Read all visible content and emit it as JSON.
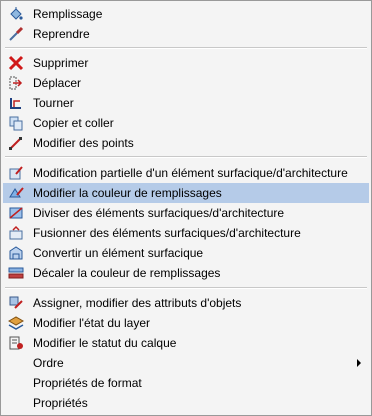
{
  "menu": {
    "items": [
      {
        "label": "Remplissage",
        "icon": "paint-bucket-icon"
      },
      {
        "label": "Reprendre",
        "icon": "eyedropper-icon"
      },
      {
        "label": "Supprimer",
        "icon": "delete-x-icon"
      },
      {
        "label": "Déplacer",
        "icon": "move-icon"
      },
      {
        "label": "Tourner",
        "icon": "rotate-icon"
      },
      {
        "label": "Copier et coller",
        "icon": "copy-icon"
      },
      {
        "label": "Modifier des points",
        "icon": "edit-points-icon"
      },
      {
        "label": "Modification partielle d'un élément surfacique/d'architecture",
        "icon": "partial-edit-icon"
      },
      {
        "label": "Modifier la couleur de remplissages",
        "icon": "fill-color-icon"
      },
      {
        "label": "Diviser des éléments surfaciques/d'architecture",
        "icon": "divide-icon"
      },
      {
        "label": "Fusionner des éléments surfaciques/d'architecture",
        "icon": "merge-icon"
      },
      {
        "label": "Convertir un élément surfacique",
        "icon": "convert-icon"
      },
      {
        "label": "Décaler la couleur de remplissages",
        "icon": "offset-color-icon"
      },
      {
        "label": "Assigner, modifier des attributs d'objets",
        "icon": "attributes-icon"
      },
      {
        "label": "Modifier l'état du layer",
        "icon": "layer-state-icon"
      },
      {
        "label": "Modifier le statut du calque",
        "icon": "calque-status-icon"
      },
      {
        "label": "Ordre"
      },
      {
        "label": "Propriétés de format"
      },
      {
        "label": "Propriétés"
      }
    ],
    "highlighted_item": "Modifier la couleur de remplissages",
    "submenu_item": "Ordre",
    "colors": {
      "highlight": "#b5cbe8",
      "background": "#f4f4f4"
    }
  }
}
